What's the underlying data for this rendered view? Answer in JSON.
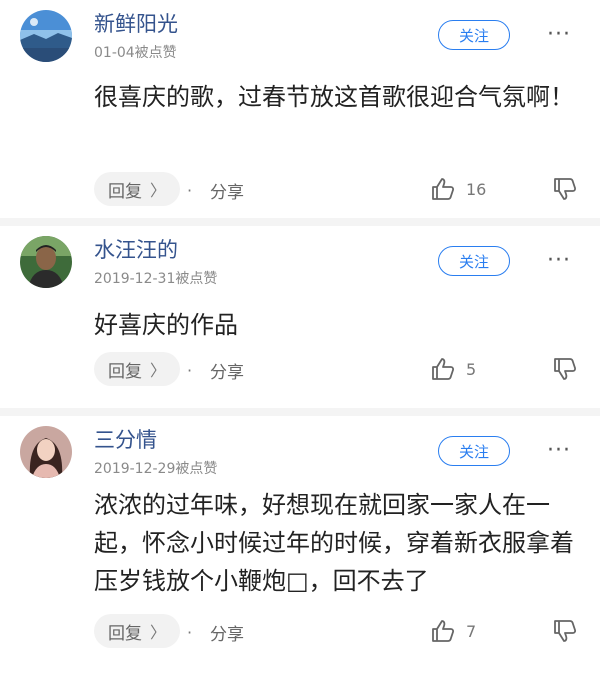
{
  "follow_label": "关注",
  "more_label": "···",
  "reply_label": "回复",
  "reply_chevron": "〉",
  "share_label": "分享",
  "dot": "·",
  "comments": [
    {
      "name": "新鲜阳光",
      "date": "01-04被点赞",
      "text": "很喜庆的歌，过春节放这首歌很迎合气氛啊！",
      "likes": "16"
    },
    {
      "name": "水汪汪的",
      "date": "2019-12-31被点赞",
      "text": "好喜庆的作品",
      "likes": "5"
    },
    {
      "name": "三分情",
      "date": "2019-12-29被点赞",
      "text": "浓浓的过年味，好想现在就回家一家人在一起，怀念小时候过年的时候，穿着新衣服拿着压岁钱放个小鞭炮□，回不去了",
      "likes": "7"
    }
  ],
  "colors": {
    "username": "#34538d",
    "follow_accent": "#2a7ef0",
    "meta_gray": "#8a8a8a"
  },
  "icons": [
    "thumbs-up-icon",
    "thumbs-down-icon",
    "more-icon"
  ]
}
